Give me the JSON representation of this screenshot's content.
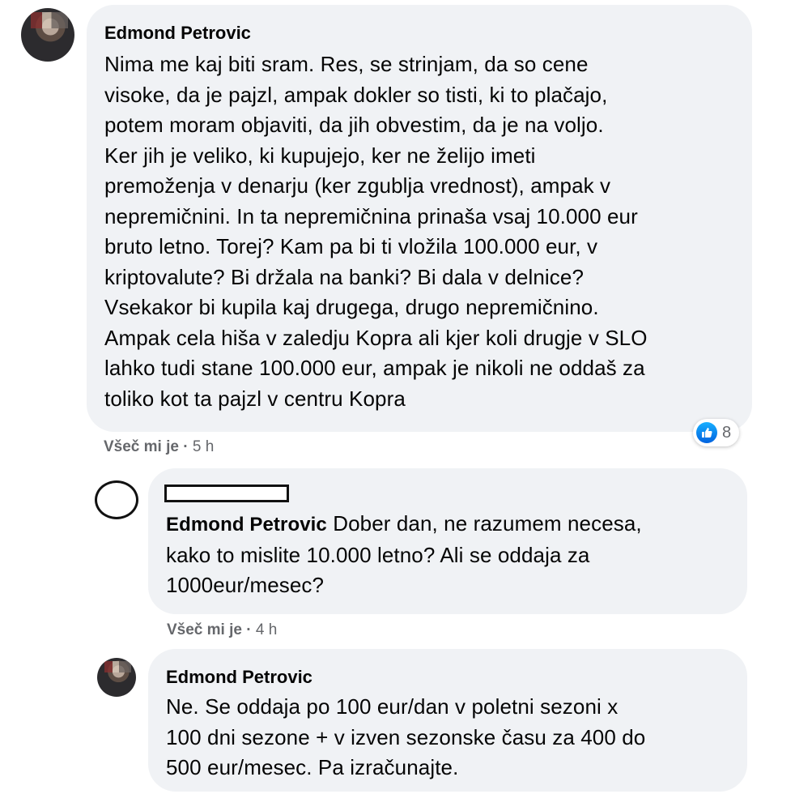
{
  "comments": [
    {
      "author": "Edmond Petrovic",
      "lines": [
        "Nima me kaj biti sram. Res, se strinjam, da so cene",
        "visoke, da je pajzl, ampak dokler so tisti, ki to plačajo,",
        "potem moram objaviti, da jih obvestim, da je na voljo.",
        "Ker jih je veliko, ki kupujejo, ker ne želijo imeti",
        "premoženja v denarju (ker zgublja vrednost), ampak v",
        "nepremičnini. In ta nepremičnina prinaša vsaj 10.000 eur",
        "bruto letno. Torej? Kam pa bi ti vložila 100.000 eur, v",
        "kriptovalute? Bi držala na banki? Bi dala v delnice?",
        "Vsekakor bi kupila kaj drugega, drugo nepremičnino.",
        "Ampak cela hiša v zaledju Kopra ali kjer koli drugje v SLO",
        "lahko tudi stane 100.000 eur, ampak je nikoli ne oddaš za",
        "toliko kot ta pajzl v centru Kopra"
      ],
      "like_label": "Všeč mi je",
      "time": "5 h",
      "reaction_count": "8",
      "reaction_icon": "thumbs-up-icon"
    },
    {
      "author": "",
      "mention": "Edmond Petrovic",
      "lines": [
        "Dober dan, ne razumem necesa,",
        "kako to mislite 10.000 letno? Ali se oddaja za",
        "1000eur/mesec?"
      ],
      "like_label": "Všeč mi je",
      "time": "4 h"
    },
    {
      "author": "Edmond Petrovic",
      "lines": [
        "Ne. Se oddaja po 100 eur/dan v poletni sezoni x",
        "100 dni sezone + v izven sezonske času za 400 do",
        "500 eur/mesec. Pa izračunajte."
      ]
    }
  ],
  "separator": "·",
  "colors": {
    "bubble": "#f0f2f5",
    "meta": "#65676b",
    "like_blue": "#0866ff"
  }
}
